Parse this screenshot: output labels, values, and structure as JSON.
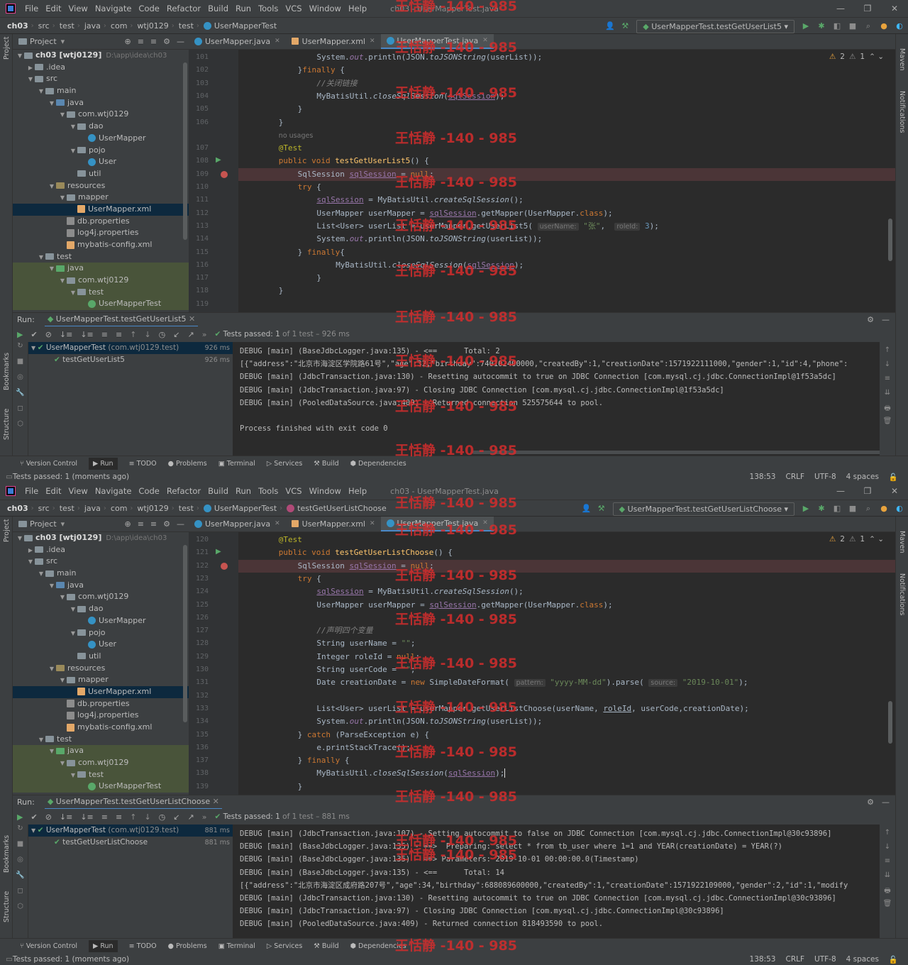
{
  "menu": [
    "File",
    "Edit",
    "View",
    "Navigate",
    "Code",
    "Refactor",
    "Build",
    "Run",
    "Tools",
    "VCS",
    "Window",
    "Help"
  ],
  "window_title": "ch03 - UserMapperTest.java",
  "watermark": "王恬静 -140 - 985",
  "project_label": "Project",
  "run_label": "Run:",
  "tool_tabs": [
    "Version Control",
    "Run",
    "TODO",
    "Problems",
    "Terminal",
    "Services",
    "Build",
    "Dependencies"
  ],
  "side_labels": {
    "project": "Project",
    "bookmarks": "Bookmarks",
    "structure": "Structure",
    "maven": "Maven",
    "notifications": "Notifications"
  },
  "tree": [
    {
      "label": "ch03 [wtj0129]",
      "extra": "D:\\app\\idea\\ch03",
      "indent": 0,
      "icon": "fold",
      "caret": "v"
    },
    {
      "label": ".idea",
      "indent": 1,
      "icon": "fold",
      "caret": ">"
    },
    {
      "label": "src",
      "indent": 1,
      "icon": "fold",
      "caret": "v"
    },
    {
      "label": "main",
      "indent": 2,
      "icon": "fold",
      "caret": "v"
    },
    {
      "label": "java",
      "indent": 3,
      "icon": "src",
      "caret": "v"
    },
    {
      "label": "com.wtj0129",
      "indent": 4,
      "icon": "fold",
      "caret": "v"
    },
    {
      "label": "dao",
      "indent": 5,
      "icon": "fold",
      "caret": "v"
    },
    {
      "label": "UserMapper",
      "indent": 6,
      "icon": "cls",
      "caret": ""
    },
    {
      "label": "pojo",
      "indent": 5,
      "icon": "fold",
      "caret": "v"
    },
    {
      "label": "User",
      "indent": 6,
      "icon": "cls",
      "caret": ""
    },
    {
      "label": "util",
      "indent": 5,
      "icon": "fold",
      "caret": ""
    },
    {
      "label": "resources",
      "indent": 3,
      "icon": "res",
      "caret": "v"
    },
    {
      "label": "mapper",
      "indent": 4,
      "icon": "fold",
      "caret": "v"
    },
    {
      "label": "UserMapper.xml",
      "indent": 5,
      "icon": "xml",
      "caret": "",
      "sel": true
    },
    {
      "label": "db.properties",
      "indent": 4,
      "icon": "prop",
      "caret": ""
    },
    {
      "label": "log4j.properties",
      "indent": 4,
      "icon": "prop",
      "caret": ""
    },
    {
      "label": "mybatis-config.xml",
      "indent": 4,
      "icon": "xml",
      "caret": ""
    },
    {
      "label": "test",
      "indent": 2,
      "icon": "fold",
      "caret": "v"
    },
    {
      "label": "java",
      "indent": 3,
      "icon": "tst",
      "caret": "v",
      "green": true
    },
    {
      "label": "com.wtj0129",
      "indent": 4,
      "icon": "fold",
      "caret": "v",
      "green": true
    },
    {
      "label": "test",
      "indent": 5,
      "icon": "fold",
      "caret": "v",
      "green": true
    },
    {
      "label": "UserMapperTest",
      "indent": 6,
      "icon": "jv",
      "caret": "",
      "green": true
    }
  ],
  "editor_tabs": [
    "UserMapper.java",
    "UserMapper.xml",
    "UserMapperTest.java"
  ],
  "panes": [
    {
      "breadcrumb": [
        "ch03",
        "src",
        "test",
        "java",
        "com",
        "wtj0129",
        "test",
        "UserMapperTest"
      ],
      "run_config": "UserMapperTest.testGetUserList5",
      "run_tab": "UserMapperTest.testGetUserList5",
      "passed": "Tests passed:",
      "passed_count": "1",
      "passed_rest": "of 1 test – 926 ms",
      "warn": "2",
      "weak": "1",
      "test_root": "UserMapperTest",
      "test_root_pkg": "(com.wtj0129.test)",
      "test_root_time": "926 ms",
      "test_child": "testGetUserList5",
      "test_child_time": "926 ms",
      "status_left": "Tests passed: 1 (moments ago)",
      "status_right": [
        "138:53",
        "CRLF",
        "UTF-8",
        "4 spaces"
      ],
      "line_numbers": [
        "101",
        "102",
        "103",
        "104",
        "105",
        "106",
        "",
        "107",
        "108",
        "109",
        "110",
        "111",
        "112",
        "113",
        "114",
        "115",
        "116",
        "117",
        "118",
        "119"
      ],
      "console": [
        "DEBUG [main] (BaseJdbcLogger.java:135) - <==      Total: 2",
        "[{\"address\":\"北京市海淀区学院路61号\",\"age\":32,\"birthday\":740102400000,\"createdBy\":1,\"creationDate\":1571922111000,\"gender\":1,\"id\":4,\"phone\":",
        "DEBUG [main] (JdbcTransaction.java:130) - Resetting autocommit to true on JDBC Connection [com.mysql.cj.jdbc.ConnectionImpl@1f53a5dc]",
        "DEBUG [main] (JdbcTransaction.java:97) - Closing JDBC Connection [com.mysql.cj.jdbc.ConnectionImpl@1f53a5dc]",
        "DEBUG [main] (PooledDataSource.java:409) - Returned connection 525575644 to pool.",
        "",
        "Process finished with exit code 0"
      ]
    },
    {
      "breadcrumb": [
        "ch03",
        "src",
        "test",
        "java",
        "com",
        "wtj0129",
        "test",
        "UserMapperTest",
        "testGetUserListChoose"
      ],
      "run_config": "UserMapperTest.testGetUserListChoose",
      "run_tab": "UserMapperTest.testGetUserListChoose",
      "passed": "Tests passed:",
      "passed_count": "1",
      "passed_rest": "of 1 test – 881 ms",
      "warn": "2",
      "weak": "1",
      "test_root": "UserMapperTest",
      "test_root_pkg": "(com.wtj0129.test)",
      "test_root_time": "881 ms",
      "test_child": "testGetUserListChoose",
      "test_child_time": "881 ms",
      "status_left": "Tests passed: 1 (moments ago)",
      "status_right": [
        "138:53",
        "CRLF",
        "UTF-8",
        "4 spaces"
      ],
      "line_numbers": [
        "120",
        "121",
        "122",
        "123",
        "124",
        "125",
        "126",
        "127",
        "128",
        "129",
        "130",
        "131",
        "132",
        "133",
        "134",
        "135",
        "136",
        "137",
        "138",
        "139"
      ],
      "console": [
        "DEBUG [main] (JdbcTransaction.java:107) - Setting autocommit to false on JDBC Connection [com.mysql.cj.jdbc.ConnectionImpl@30c93896]",
        "DEBUG [main] (BaseJdbcLogger.java:135) - ==>  Preparing: select * from tb_user where 1=1 and YEAR(creationDate) = YEAR(?)",
        "DEBUG [main] (BaseJdbcLogger.java:135) - ==> Parameters: 2019-10-01 00:00:00.0(Timestamp)",
        "DEBUG [main] (BaseJdbcLogger.java:135) - <==      Total: 14",
        "[{\"address\":\"北京市海淀区成府路207号\",\"age\":34,\"birthday\":688089600000,\"createdBy\":1,\"creationDate\":1571922109000,\"gender\":2,\"id\":1,\"modify",
        "DEBUG [main] (JdbcTransaction.java:130) - Resetting autocommit to true on JDBC Connection [com.mysql.cj.jdbc.ConnectionImpl@30c93896]",
        "DEBUG [main] (JdbcTransaction.java:97) - Closing JDBC Connection [com.mysql.cj.jdbc.ConnectionImpl@30c93896]",
        "DEBUG [main] (PooledDataSource.java:409) - Returned connection 818493590 to pool."
      ]
    }
  ]
}
